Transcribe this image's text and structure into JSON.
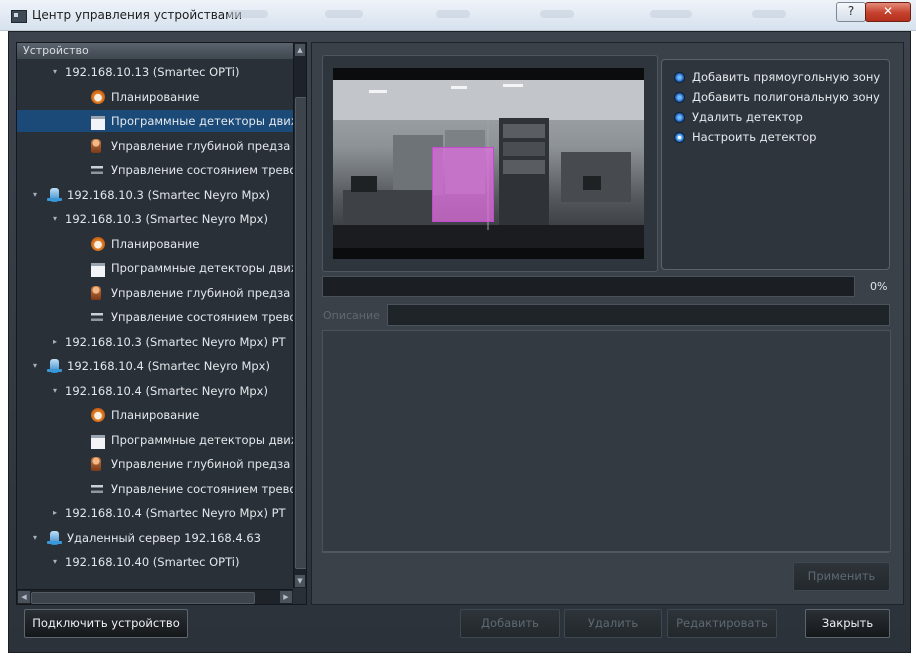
{
  "window": {
    "title": "Центр управления устройствами",
    "help_label": "?",
    "close_label": "✕"
  },
  "tree": {
    "header": "Устройство",
    "rows": [
      {
        "text": "192.168.10.13 (Smartec OPTi)",
        "icon": "none",
        "expander": "expanded",
        "selected": false
      },
      {
        "text": "Планирование",
        "icon": "clock-icon",
        "expander": "none",
        "selected": false
      },
      {
        "text": "Программные детекторы движ",
        "icon": "detector-icon",
        "expander": "none",
        "selected": true
      },
      {
        "text": "Управление глубиной предза",
        "icon": "depth-icon",
        "expander": "none",
        "selected": false
      },
      {
        "text": "Управление состоянием трево",
        "icon": "state-icon",
        "expander": "none",
        "selected": false
      },
      {
        "text": "192.168.10.3 (Smartec Neyro Mpx)",
        "icon": "server-icon",
        "expander": "expanded",
        "selected": false
      },
      {
        "text": "192.168.10.3 (Smartec Neyro Mpx)",
        "icon": "none",
        "expander": "expanded",
        "selected": false
      },
      {
        "text": "Планирование",
        "icon": "clock-icon",
        "expander": "none",
        "selected": false
      },
      {
        "text": "Программные детекторы движ",
        "icon": "detector-icon",
        "expander": "none",
        "selected": false
      },
      {
        "text": "Управление глубиной предза",
        "icon": "depth-icon",
        "expander": "none",
        "selected": false
      },
      {
        "text": "Управление состоянием трево",
        "icon": "state-icon",
        "expander": "none",
        "selected": false
      },
      {
        "text": "192.168.10.3 (Smartec Neyro Mpx) PT",
        "icon": "none",
        "expander": "collapsed",
        "selected": false
      },
      {
        "text": "192.168.10.4 (Smartec Neyro Mpx)",
        "icon": "server-icon",
        "expander": "expanded",
        "selected": false
      },
      {
        "text": "192.168.10.4 (Smartec Neyro Mpx)",
        "icon": "none",
        "expander": "expanded",
        "selected": false
      },
      {
        "text": "Планирование",
        "icon": "clock-icon",
        "expander": "none",
        "selected": false
      },
      {
        "text": "Программные детекторы движ",
        "icon": "detector-icon",
        "expander": "none",
        "selected": false
      },
      {
        "text": "Управление глубиной предза",
        "icon": "depth-icon",
        "expander": "none",
        "selected": false
      },
      {
        "text": "Управление состоянием трево",
        "icon": "state-icon",
        "expander": "none",
        "selected": false
      },
      {
        "text": "192.168.10.4 (Smartec Neyro Mpx) PT",
        "icon": "none",
        "expander": "collapsed",
        "selected": false
      },
      {
        "text": "Удаленный сервер 192.168.4.63",
        "icon": "server-icon",
        "expander": "expanded",
        "selected": false
      },
      {
        "text": "192.168.10.40 (Smartec OPTi)",
        "icon": "none",
        "expander": "expanded",
        "selected": false
      }
    ]
  },
  "options": [
    {
      "label": "Добавить прямоугольную зону",
      "selected": false
    },
    {
      "label": "Добавить полигональную зону",
      "selected": false
    },
    {
      "label": "Удалить детектор",
      "selected": false
    },
    {
      "label": "Настроить детектор",
      "selected": true
    }
  ],
  "progress": {
    "percent_label": "0%",
    "value": 0
  },
  "description": {
    "label": "Описание",
    "value": ""
  },
  "buttons": {
    "apply": "Применить",
    "connect": "Подключить устройство",
    "add": "Добавить",
    "delete": "Удалить",
    "edit": "Редактировать",
    "close": "Закрыть"
  },
  "colors": {
    "selection": "#1b4a78",
    "zone": "#e26ee2",
    "panel": "#2a3038"
  }
}
